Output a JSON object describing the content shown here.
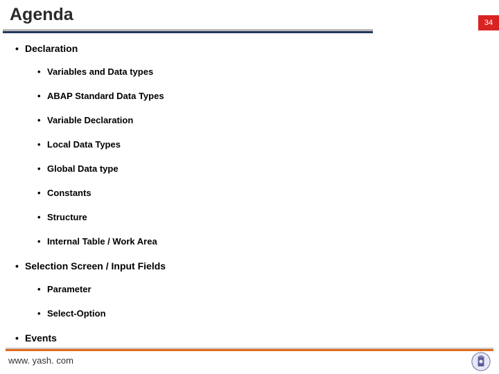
{
  "header": {
    "title": "Agenda",
    "page_number": "34"
  },
  "agenda": [
    {
      "label": "Declaration",
      "children": [
        {
          "label": "Variables and Data types"
        },
        {
          "label": "ABAP Standard Data Types"
        },
        {
          "label": "Variable Declaration"
        },
        {
          "label": "Local Data Types"
        },
        {
          "label": "Global Data type"
        },
        {
          "label": "Constants"
        },
        {
          "label": "Structure"
        },
        {
          "label": "Internal Table / Work Area"
        }
      ]
    },
    {
      "label": "Selection Screen / Input Fields",
      "children": [
        {
          "label": "Parameter"
        },
        {
          "label": "Select-Option"
        }
      ]
    },
    {
      "label": "Events",
      "children": []
    }
  ],
  "footer": {
    "url": "www. yash. com"
  }
}
